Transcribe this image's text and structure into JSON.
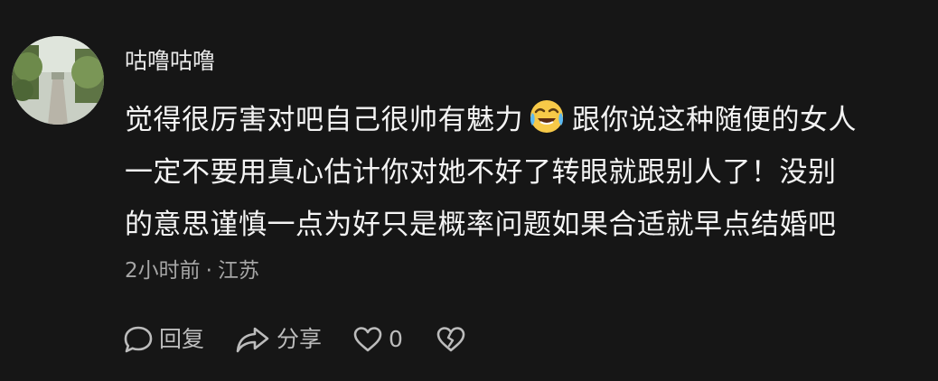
{
  "comment": {
    "username": "咕噜咕噜",
    "text_lines": [
      "觉得很厉害对吧自己很帅有魅力",
      "跟你说这种随便的女人",
      "一定不要用真心估计你对她不好了转眼就跟别人了！没别",
      "的意思谨慎一点为好只是概率问题如果合适就早点结婚吧"
    ],
    "emoji": "laughing-crying-emoji",
    "time": "2小时前",
    "separator": "·",
    "location": "江苏"
  },
  "actions": {
    "reply_label": "回复",
    "share_label": "分享",
    "like_count": "0"
  },
  "colors": {
    "background": "#161616",
    "text": "#f4f4f4",
    "muted": "#a6a6a6",
    "icon": "#bcbcbc"
  }
}
